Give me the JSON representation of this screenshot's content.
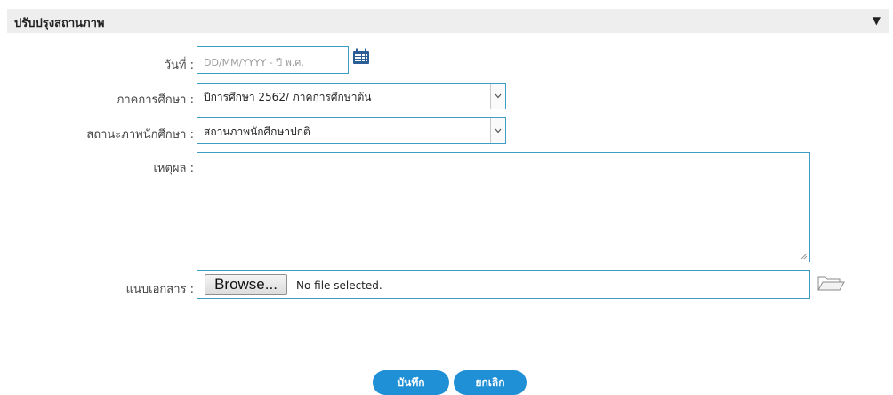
{
  "panel": {
    "title": "ปรับปรุงสถานภาพ",
    "toggle_glyph": "▼"
  },
  "form": {
    "date": {
      "label": "วันที่ :",
      "placeholder": "DD/MM/YYYY - ปี พ.ศ.",
      "value": ""
    },
    "semester": {
      "label": "ภาคการศึกษา :",
      "selected": "ปีการศึกษา 2562/ ภาคการศึกษาต้น"
    },
    "student_status": {
      "label": "สถานะภาพนักศึกษา :",
      "selected": "สถานภาพนักศึกษาปกติ"
    },
    "reason": {
      "label": "เหตุผล :",
      "value": ""
    },
    "attachment": {
      "label": "แนบเอกสาร :",
      "browse_label": "Browse...",
      "status": "No file selected."
    }
  },
  "actions": {
    "save_label": "บันทึก",
    "cancel_label": "ยกเลิก"
  },
  "icons": {
    "calendar": "calendar-icon",
    "folder": "folder-open-icon",
    "dropdown": "chevron-down-icon"
  },
  "colors": {
    "accent": "#1f8fd6",
    "field_border": "#3f9cc4",
    "header_bg": "#eeeeee",
    "calendar": "#2a5d94"
  }
}
